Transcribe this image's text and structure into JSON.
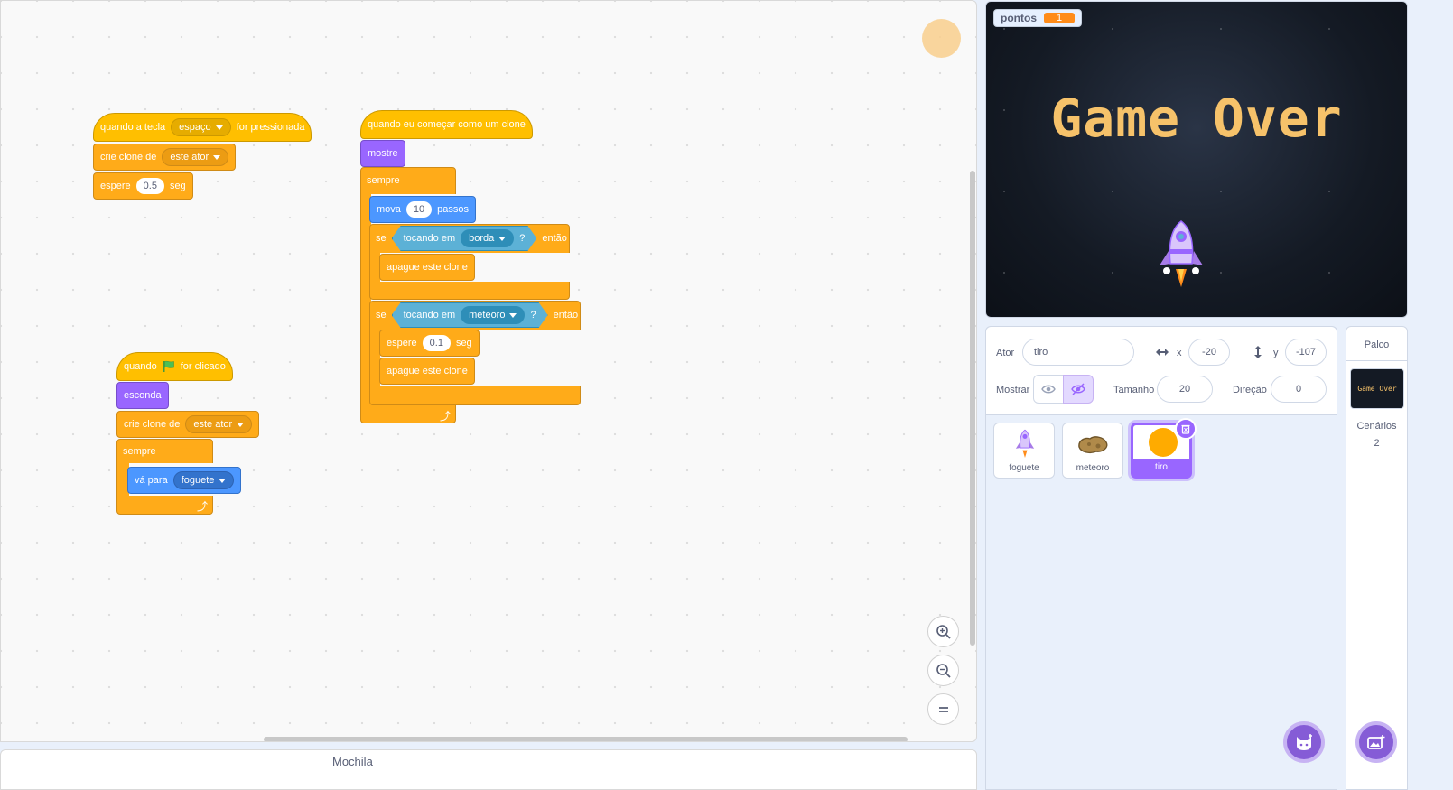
{
  "code": {
    "script1": {
      "hat_prefix": "quando a tecla",
      "key_option": "espaço",
      "hat_suffix": "for pressionada",
      "clone_label": "crie clone de",
      "clone_option": "este ator",
      "wait_label": "espere",
      "wait_value": "0.5",
      "wait_unit": "seg"
    },
    "script2": {
      "hat_prefix": "quando",
      "hat_suffix": "for clicado",
      "hide_label": "esconda",
      "clone_label": "crie clone de",
      "clone_option": "este ator",
      "forever_label": "sempre",
      "goto_label": "vá para",
      "goto_option": "foguete"
    },
    "script3": {
      "hat_label": "quando eu começar como um clone",
      "show_label": "mostre",
      "forever_label": "sempre",
      "move_label": "mova",
      "move_value": "10",
      "move_unit": "passos",
      "if_label": "se",
      "touching_label": "tocando em",
      "touching_option1": "borda",
      "question": "?",
      "then_label": "então",
      "delete_label": "apague este clone",
      "touching_option2": "meteoro",
      "wait_label": "espere",
      "wait_value": "0.1",
      "wait_unit": "seg"
    }
  },
  "backpack": {
    "label": "Mochila"
  },
  "stage": {
    "monitor_label": "pontos",
    "monitor_value": "1",
    "game_over_text": "Game Over"
  },
  "sprite_info": {
    "sprite_label": "Ator",
    "sprite_name": "tiro",
    "x_label": "x",
    "x_value": "-20",
    "y_label": "y",
    "y_value": "-107",
    "show_label": "Mostrar",
    "size_label": "Tamanho",
    "size_value": "20",
    "direction_label": "Direção",
    "direction_value": "0"
  },
  "sprites": [
    {
      "name": "foguete"
    },
    {
      "name": "meteoro"
    },
    {
      "name": "tiro"
    }
  ],
  "stage_pane": {
    "title": "Palco",
    "backdrops_label": "Cenários",
    "backdrops_count": "2",
    "backdrop_thumb_text": "Game Over"
  },
  "colors": {
    "events": "#ffbf00",
    "control": "#ffab19",
    "looks": "#9966ff",
    "motion": "#4c97ff",
    "sensing": "#5cb1d6",
    "selected": "#9966ff"
  },
  "icons": [
    "green-flag-icon",
    "loop-arrow-icon",
    "zoom-in-icon",
    "zoom-out-icon",
    "zoom-reset-icon",
    "eye-icon",
    "eye-off-icon",
    "horizontal-arrows-icon",
    "vertical-arrows-icon",
    "delete-icon",
    "choose-sprite-icon",
    "choose-backdrop-icon"
  ]
}
